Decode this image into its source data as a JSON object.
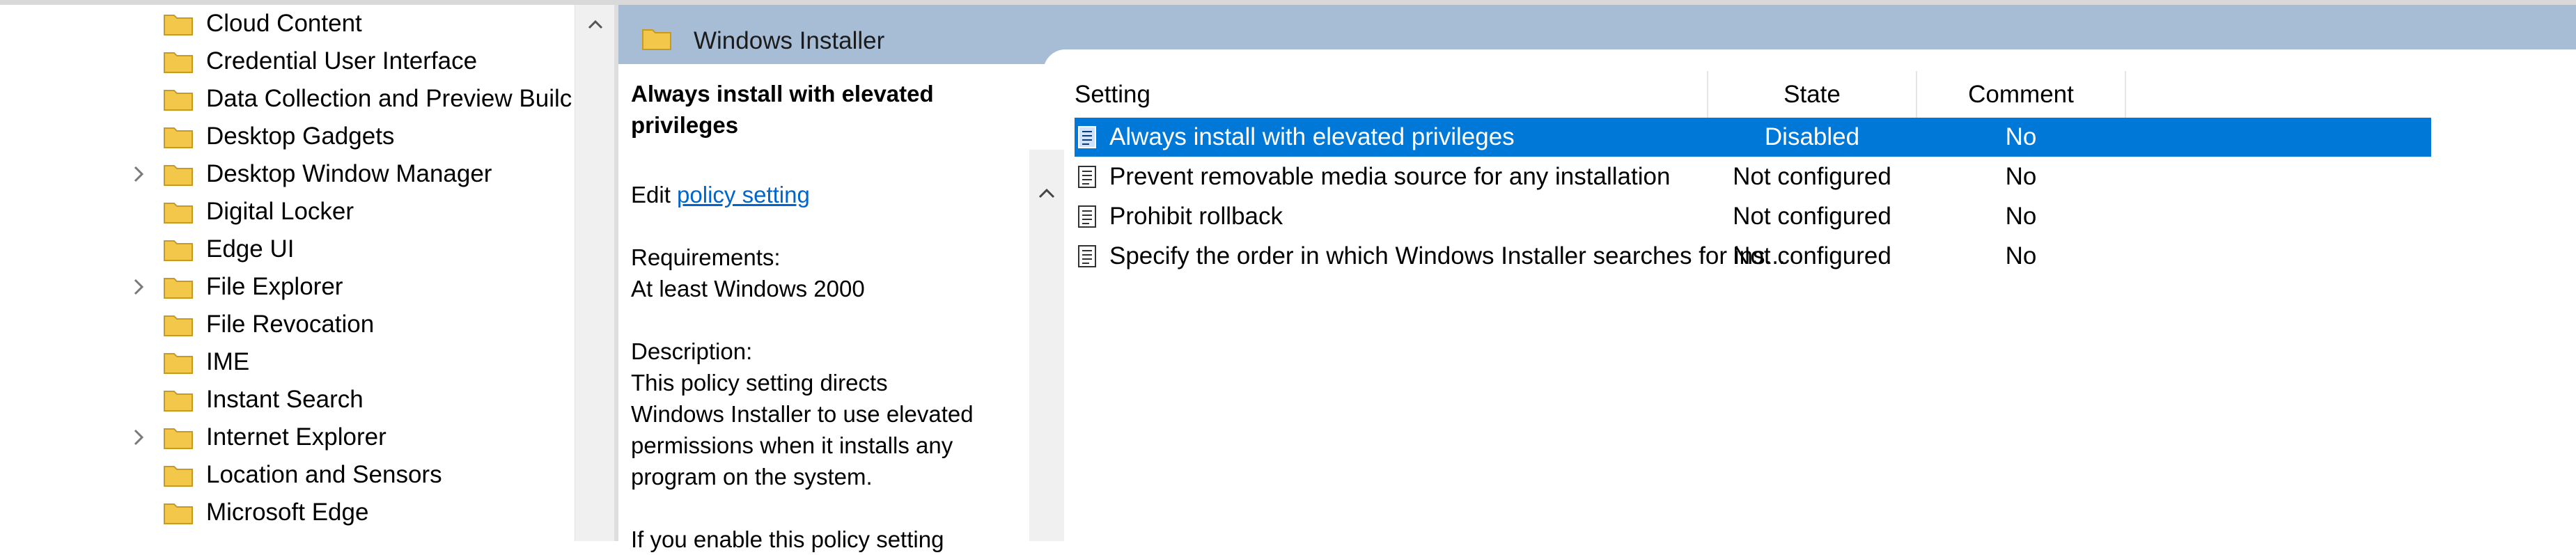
{
  "tree": {
    "items": [
      {
        "label": "Cloud Content",
        "has_children": false
      },
      {
        "label": "Credential User Interface",
        "has_children": false
      },
      {
        "label": "Data Collection and Preview Builc",
        "has_children": false
      },
      {
        "label": "Desktop Gadgets",
        "has_children": false
      },
      {
        "label": "Desktop Window Manager",
        "has_children": true
      },
      {
        "label": "Digital Locker",
        "has_children": false
      },
      {
        "label": "Edge UI",
        "has_children": false
      },
      {
        "label": "File Explorer",
        "has_children": true
      },
      {
        "label": "File Revocation",
        "has_children": false
      },
      {
        "label": "IME",
        "has_children": false
      },
      {
        "label": "Instant Search",
        "has_children": false
      },
      {
        "label": "Internet Explorer",
        "has_children": true
      },
      {
        "label": "Location and Sensors",
        "has_children": false
      },
      {
        "label": "Microsoft Edge",
        "has_children": false
      }
    ]
  },
  "right_pane": {
    "title": "Windows Installer"
  },
  "description": {
    "title_line1": "Always install with elevated",
    "title_line2": "privileges",
    "edit_prefix": "Edit",
    "edit_link": "policy setting",
    "requirements_label": "Requirements:",
    "requirements_value": "At least Windows 2000",
    "description_label": "Description:",
    "description_lines": [
      "This policy setting directs",
      "Windows Installer to use elevated",
      "permissions when it installs any",
      "program on the system."
    ],
    "cut_line": "If you enable this policy setting"
  },
  "list": {
    "columns": {
      "setting": "Setting",
      "state": "State",
      "comment": "Comment"
    },
    "rows": [
      {
        "setting": "Always install with elevated privileges",
        "state": "Disabled",
        "comment": "No",
        "selected": true
      },
      {
        "setting": "Prevent removable media source for any installation",
        "state": "Not configured",
        "comment": "No",
        "selected": false
      },
      {
        "setting": "Prohibit rollback",
        "state": "Not configured",
        "comment": "No",
        "selected": false
      },
      {
        "setting": "Specify the order in which Windows Installer searches for ins...",
        "state": "Not configured",
        "comment": "No",
        "selected": false
      }
    ]
  },
  "colors": {
    "selection": "#0078d7",
    "header_band": "#a7bcd5",
    "folder": "#f3c84a",
    "link": "#0066cc"
  },
  "icons": {
    "folder": "folder-icon",
    "expander": "chevron-right-icon",
    "scroll_up": "chevron-up-icon",
    "policy": "policy-setting-icon"
  }
}
